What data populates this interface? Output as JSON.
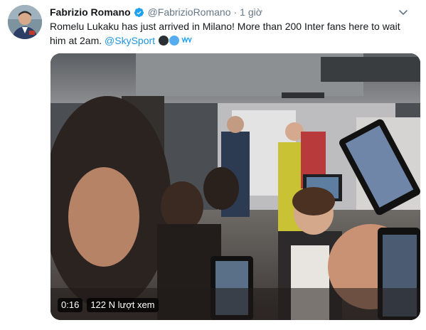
{
  "tweet": {
    "display_name": "Fabrizio Romano",
    "handle": "@FabrizioRomano",
    "separator": "·",
    "time": "1 giờ",
    "text_main": "Romelu Lukaku has just arrived in Milano! More than 200 Inter fans here to wait him at 2am. ",
    "mention": "@SkySport",
    "emojis": [
      "black-circle-emoji",
      "blue-circle-emoji",
      "flag-emoji"
    ]
  },
  "video": {
    "duration": "0:16",
    "views": "122 N lượt xem"
  },
  "colors": {
    "accent": "#1b95e0",
    "verified": "#1da1f2",
    "secondary_text": "#657786"
  }
}
